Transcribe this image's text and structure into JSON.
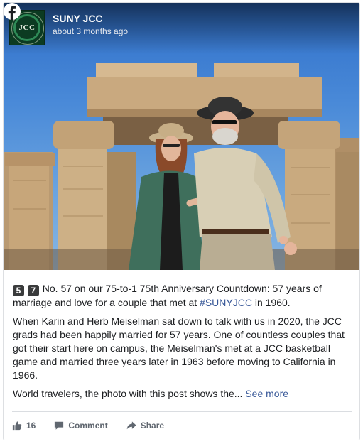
{
  "post": {
    "author": "SUNY JCC",
    "timestamp": "about 3 months ago",
    "logo_text": "JCC",
    "badges": [
      "5",
      "7"
    ],
    "paragraph1_text": "No. 57 on our 75-to-1 75th Anniversary Countdown: 57 years of marriage and love for a couple that met at ",
    "hashtag": "#SUNYJCC",
    "paragraph1_tail": " in 1960.",
    "paragraph2": "When Karin and Herb Meiselman sat down to talk with us in 2020, the JCC grads had been happily married for 57 years. One of countless couples that got their start here on campus, the Meiselman's met at a JCC basketball game and married three years later in 1963 before moving to California in 1966.",
    "paragraph3": "World travelers, the photo with this post shows the...",
    "see_more": "See more"
  },
  "footer": {
    "like_count": "16",
    "comment_label": "Comment",
    "share_label": "Share"
  },
  "colors": {
    "link": "#385898",
    "muted": "#606770",
    "facebook": "#ffffff"
  }
}
